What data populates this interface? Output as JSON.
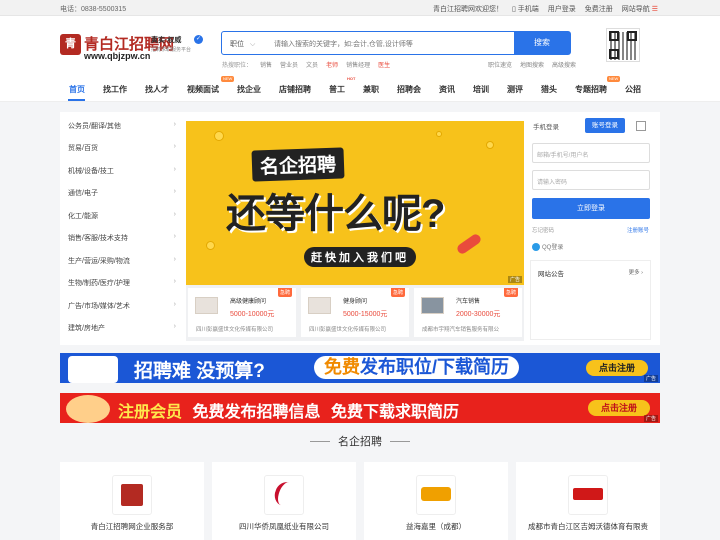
{
  "topbar": {
    "phone": "电话：0838-5500315",
    "welcome": "青白江招聘网欢迎您！",
    "mobile": "手机端",
    "login": "用户登录",
    "register": "免费注册",
    "sitenav": "网站导航"
  },
  "logo": {
    "name": "青白江招聘网",
    "url": "www.qbjzpw.cn",
    "slogan": "真实·权威",
    "sub": "招聘求职服务平台"
  },
  "search": {
    "category": "职位",
    "placeholder": "请输入搜索的关键字，如:会计,仓管,设计师等",
    "button": "搜索"
  },
  "hot": {
    "label": "热搜职位：",
    "items": [
      "销售",
      "营业员",
      "文员",
      "老师",
      "销售经理",
      "医生"
    ],
    "links": [
      "职位速览",
      "地图搜索",
      "高级搜索"
    ]
  },
  "nav": {
    "items": [
      "首页",
      "找工作",
      "找人才",
      "视频面试",
      "找企业",
      "店铺招聘",
      "普工",
      "兼职",
      "招聘会",
      "资讯",
      "培训",
      "测评",
      "猎头",
      "专题招聘",
      "公招"
    ],
    "tag_new": "NEW",
    "tag_hot": "HOT"
  },
  "categories": [
    "公务员/翻译/其他",
    "贸易/百货",
    "机械/设备/技工",
    "通信/电子",
    "化工/能源",
    "销售/客服/技术支持",
    "生产/营运/采购/物流",
    "生物/制药/医疗/护理",
    "广告/市场/媒体/艺术",
    "建筑/房地产"
  ],
  "banner": {
    "line1": "名企招聘",
    "line2": "还等什么呢?",
    "line3": "赶快加入我们吧",
    "ad": "广告"
  },
  "jobs": [
    {
      "title": "高级健康顾问",
      "salary": "5000-10000元",
      "company": "四川彭赢盛世文化传媒有限公司",
      "tag": "急聘"
    },
    {
      "title": "健身顾问",
      "salary": "5000-15000元",
      "company": "四川彭赢盛世文化传媒有限公司",
      "tag": "急聘"
    },
    {
      "title": "汽车销售",
      "salary": "2000-30000元",
      "company": "成都市宇翔汽车销售服务有限公",
      "tag": "急聘"
    }
  ],
  "login": {
    "tab_mobile": "手机登录",
    "tab_account": "账号登录",
    "user_placeholder": "邮箱/手机号/用户名",
    "pwd_placeholder": "请输入密码",
    "submit": "立即登录",
    "forgot": "忘记密码",
    "register": "注册账号",
    "qq": "QQ登录"
  },
  "notice": {
    "title": "网站公告",
    "more": "更多"
  },
  "ad1": {
    "text": "招聘难 没预算?",
    "free": "免费",
    "text2": "发布职位/下载简历",
    "button": "点击注册",
    "tag": "广告"
  },
  "ad2": {
    "text": "注册会员",
    "text2": "免费发布招聘信息",
    "text3": "免费下载求职简历",
    "button": "点击注册",
    "tag": "广告"
  },
  "section": {
    "title": "名企招聘"
  },
  "companies": [
    {
      "name": "青白江招聘网企业服务部",
      "color": "#b32a22"
    },
    {
      "name": "四川华侨凤凰纸业有限公司",
      "color": "#c8102e"
    },
    {
      "name": "益海嘉里（成都）",
      "color": "#f0a000"
    },
    {
      "name": "成都市青白江区吉姆沃德体育有限责",
      "color": "#d01818"
    }
  ],
  "colors": {
    "primary": "#2a73e8",
    "accent": "#e94b3c",
    "banner": "#f7c21b"
  }
}
